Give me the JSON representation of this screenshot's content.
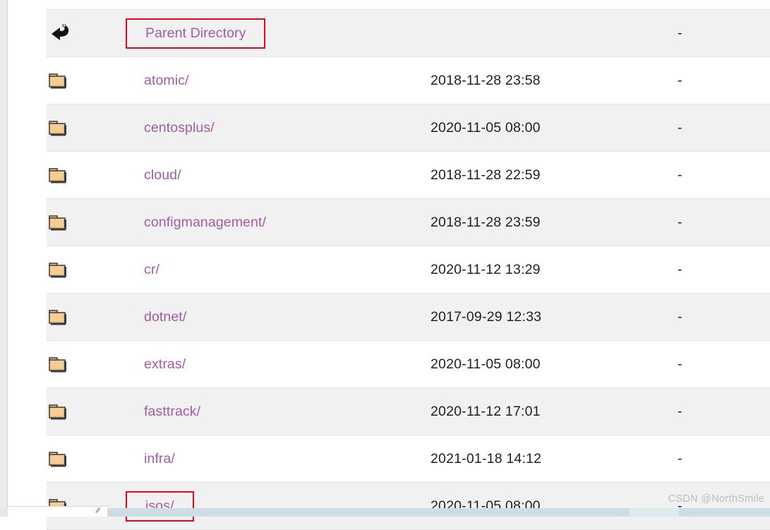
{
  "page": {
    "background_color": "#ffffff",
    "link_color": "#a35ba3",
    "highlight_color": "#e50915",
    "alt_row_color": "#f1f1f1"
  },
  "listing": {
    "columns": [
      "icon",
      "name",
      "last_modified",
      "size"
    ],
    "rows": [
      {
        "icon": "back-arrow-icon",
        "name": "Parent Directory",
        "date": "",
        "size": "-",
        "alt": true,
        "highlighted": true
      },
      {
        "icon": "folder-icon",
        "name": "atomic/",
        "date": "2018-11-28 23:58",
        "size": "-",
        "alt": false,
        "highlighted": false
      },
      {
        "icon": "folder-icon",
        "name": "centosplus/",
        "date": "2020-11-05 08:00",
        "size": "-",
        "alt": true,
        "highlighted": false
      },
      {
        "icon": "folder-icon",
        "name": "cloud/",
        "date": "2018-11-28 22:59",
        "size": "-",
        "alt": false,
        "highlighted": false
      },
      {
        "icon": "folder-icon",
        "name": "configmanagement/",
        "date": "2018-11-28 23:59",
        "size": "-",
        "alt": true,
        "highlighted": false
      },
      {
        "icon": "folder-icon",
        "name": "cr/",
        "date": "2020-11-12 13:29",
        "size": "-",
        "alt": false,
        "highlighted": false
      },
      {
        "icon": "folder-icon",
        "name": "dotnet/",
        "date": "2017-09-29 12:33",
        "size": "-",
        "alt": true,
        "highlighted": false
      },
      {
        "icon": "folder-icon",
        "name": "extras/",
        "date": "2020-11-05 08:00",
        "size": "-",
        "alt": false,
        "highlighted": false
      },
      {
        "icon": "folder-icon",
        "name": "fasttrack/",
        "date": "2020-11-12 17:01",
        "size": "-",
        "alt": true,
        "highlighted": false
      },
      {
        "icon": "folder-icon",
        "name": "infra/",
        "date": "2021-01-18 14:12",
        "size": "-",
        "alt": false,
        "highlighted": false
      },
      {
        "icon": "folder-icon",
        "name": "isos/",
        "date": "2020-11-05 08:00",
        "size": "-",
        "alt": true,
        "highlighted": true
      }
    ]
  },
  "watermark": {
    "text": "CSDN @NorthSmile"
  },
  "chrome": {
    "resize_glyph": "⫽"
  }
}
